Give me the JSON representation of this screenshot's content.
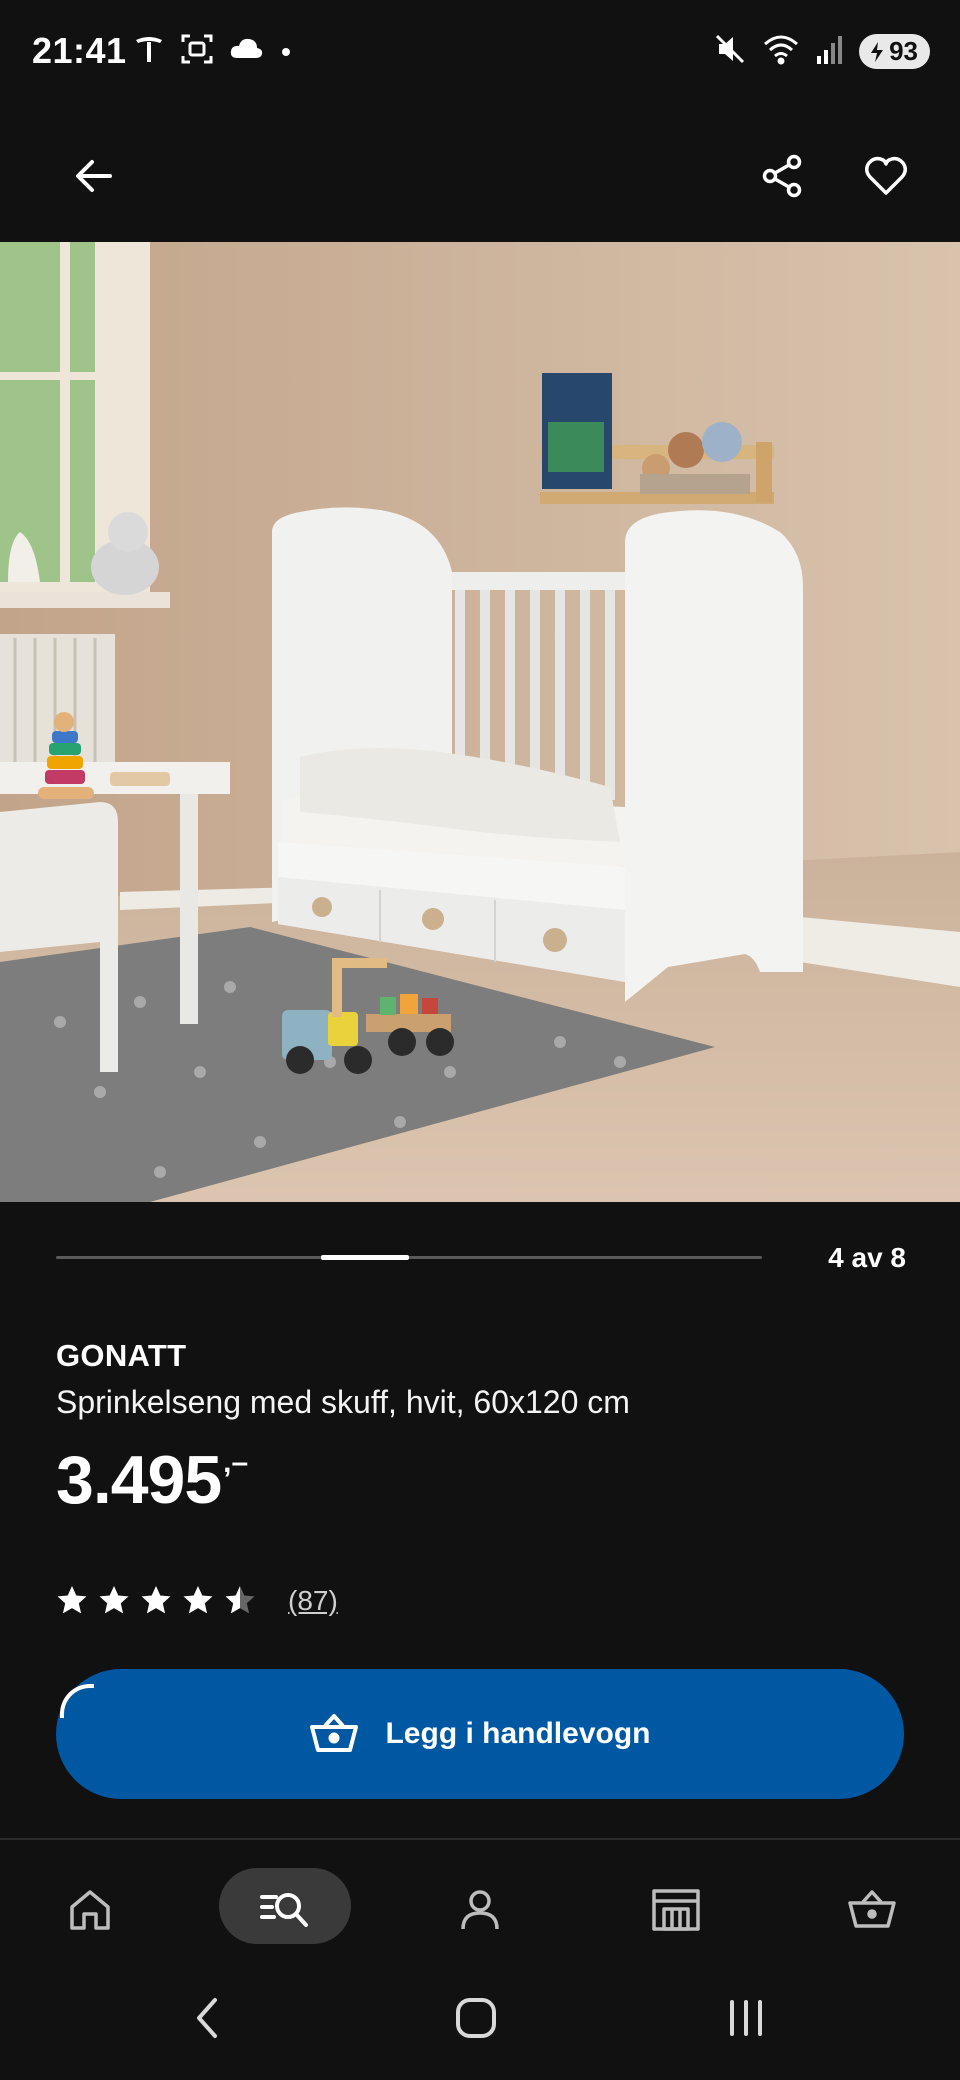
{
  "status_bar": {
    "time": "21:41",
    "battery": "93",
    "icons": [
      "tesla-icon",
      "screenshot-icon",
      "cloud-icon",
      "dot-icon",
      "mute-icon",
      "wifi-icon",
      "signal-icon",
      "battery-icon"
    ]
  },
  "top_bar": {
    "icons": [
      "back-arrow-icon",
      "share-icon",
      "heart-icon"
    ]
  },
  "carousel": {
    "counter": "4 av 8",
    "current": 4,
    "total": 8
  },
  "product": {
    "brand": "GONATT",
    "description": "Sprinkelseng med skuff, hvit, 60x120 cm",
    "price": "3.495",
    "price_suffix": ",–",
    "rating": 4.5,
    "review_count": "(87)"
  },
  "cart_button": {
    "label": "Legg i handlevogn",
    "color": "#0058a3"
  },
  "bottom_nav": {
    "items": [
      "home-icon",
      "search-icon",
      "profile-icon",
      "store-icon",
      "cart-icon"
    ],
    "active": "search-icon"
  },
  "system_nav": {
    "items": [
      "back-icon",
      "home-icon",
      "recents-icon"
    ]
  }
}
